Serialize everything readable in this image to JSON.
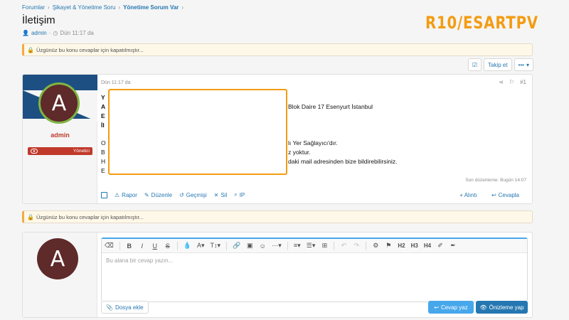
{
  "breadcrumb": [
    {
      "label": "Forumlar"
    },
    {
      "label": "Şikayet & Yönetime Soru"
    },
    {
      "label": "Yönetime Sorum Var"
    }
  ],
  "page_title": "İletişim",
  "meta": {
    "author": "admin",
    "time": "Dün 11:17 da"
  },
  "watermark": "R10/ESARTPV",
  "notice_text": "Üzgünüz bu konu cevaplar için kapatılmıştır...",
  "actions": {
    "follow_label": "Takip et",
    "more_label": "•••"
  },
  "post": {
    "user": {
      "avatar_letter": "A",
      "name": "admin",
      "role": "Yönetici"
    },
    "time": "Dün 11:17 da",
    "number": "#1",
    "lines_left": [
      "Y",
      "A",
      "E",
      "İl",
      "O",
      "B",
      "H",
      "E"
    ],
    "lines_right": [
      "Blok Daire 17 Esenyurt İstanbul",
      "lı Yer Sağlayıcı'dır.",
      "z yoktur.",
      "daki mail adresinden bize bildirebilirsiniz."
    ],
    "edited": "Son düzenleme: Bugün 14:07",
    "footer": {
      "report": "Rapor",
      "edit": "Düzenle",
      "history": "Geçmişi",
      "delete": "Sil",
      "ip": "IP",
      "quote": "+ Alıntı",
      "reply": "Cevapla"
    }
  },
  "reply_box": {
    "avatar_letter": "A",
    "placeholder": "Bu alana bir cevap yazın...",
    "attach_label": "Dosya ekle",
    "reply_label": "Cevap yaz",
    "preview_label": "Önizleme yap",
    "toolbar": {
      "h2": "H2",
      "h3": "H3",
      "h4": "H4"
    }
  }
}
